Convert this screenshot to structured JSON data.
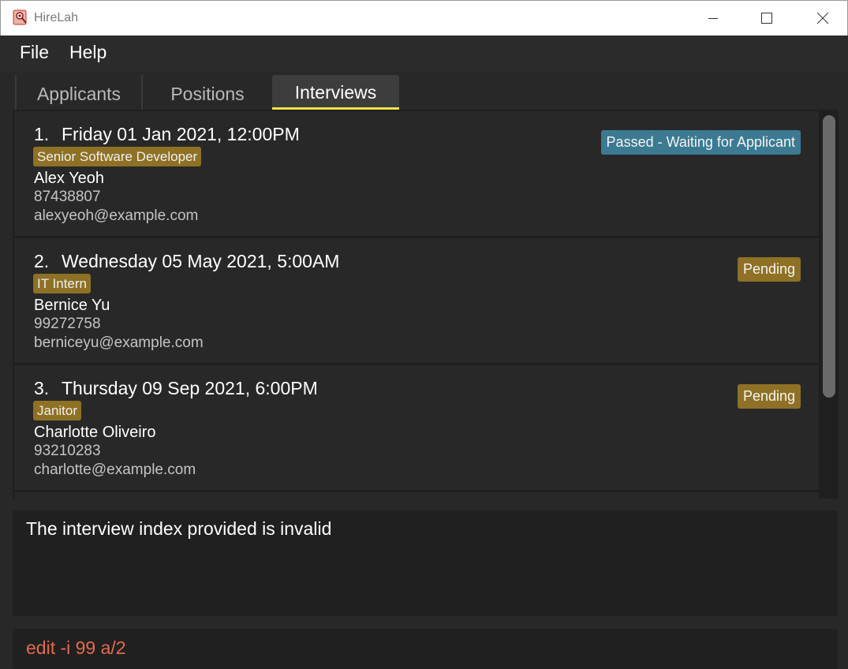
{
  "window": {
    "title": "HireLah"
  },
  "menu": {
    "items": [
      "File",
      "Help"
    ]
  },
  "tabs": [
    {
      "label": "Applicants",
      "active": false
    },
    {
      "label": "Positions",
      "active": false
    },
    {
      "label": "Interviews",
      "active": true
    }
  ],
  "interviews": [
    {
      "index": "1.",
      "datetime": "Friday 01 Jan 2021, 12:00PM",
      "position": "Senior Software Developer",
      "name": "Alex Yeoh",
      "phone": "87438807",
      "email": "alexyeoh@example.com",
      "status": "Passed - Waiting for Applicant",
      "status_color": "#3c7a92"
    },
    {
      "index": "2.",
      "datetime": "Wednesday 05 May 2021, 5:00AM",
      "position": "IT Intern",
      "name": "Bernice Yu",
      "phone": "99272758",
      "email": "berniceyu@example.com",
      "status": "Pending",
      "status_color": "#8e7125"
    },
    {
      "index": "3.",
      "datetime": "Thursday 09 Sep 2021, 6:00PM",
      "position": "Janitor",
      "name": "Charlotte Oliveiro",
      "phone": "93210283",
      "email": "charlotte@example.com",
      "status": "Pending",
      "status_color": "#8e7125"
    }
  ],
  "result": {
    "message": "The interview index provided is invalid"
  },
  "command": {
    "value": "edit -i 99 a/2"
  },
  "colors": {
    "accent_tab_underline": "#f2e24a",
    "tag_gold": "#8e7125",
    "status_blue": "#3c7a92",
    "command_text": "#e26a4d"
  }
}
